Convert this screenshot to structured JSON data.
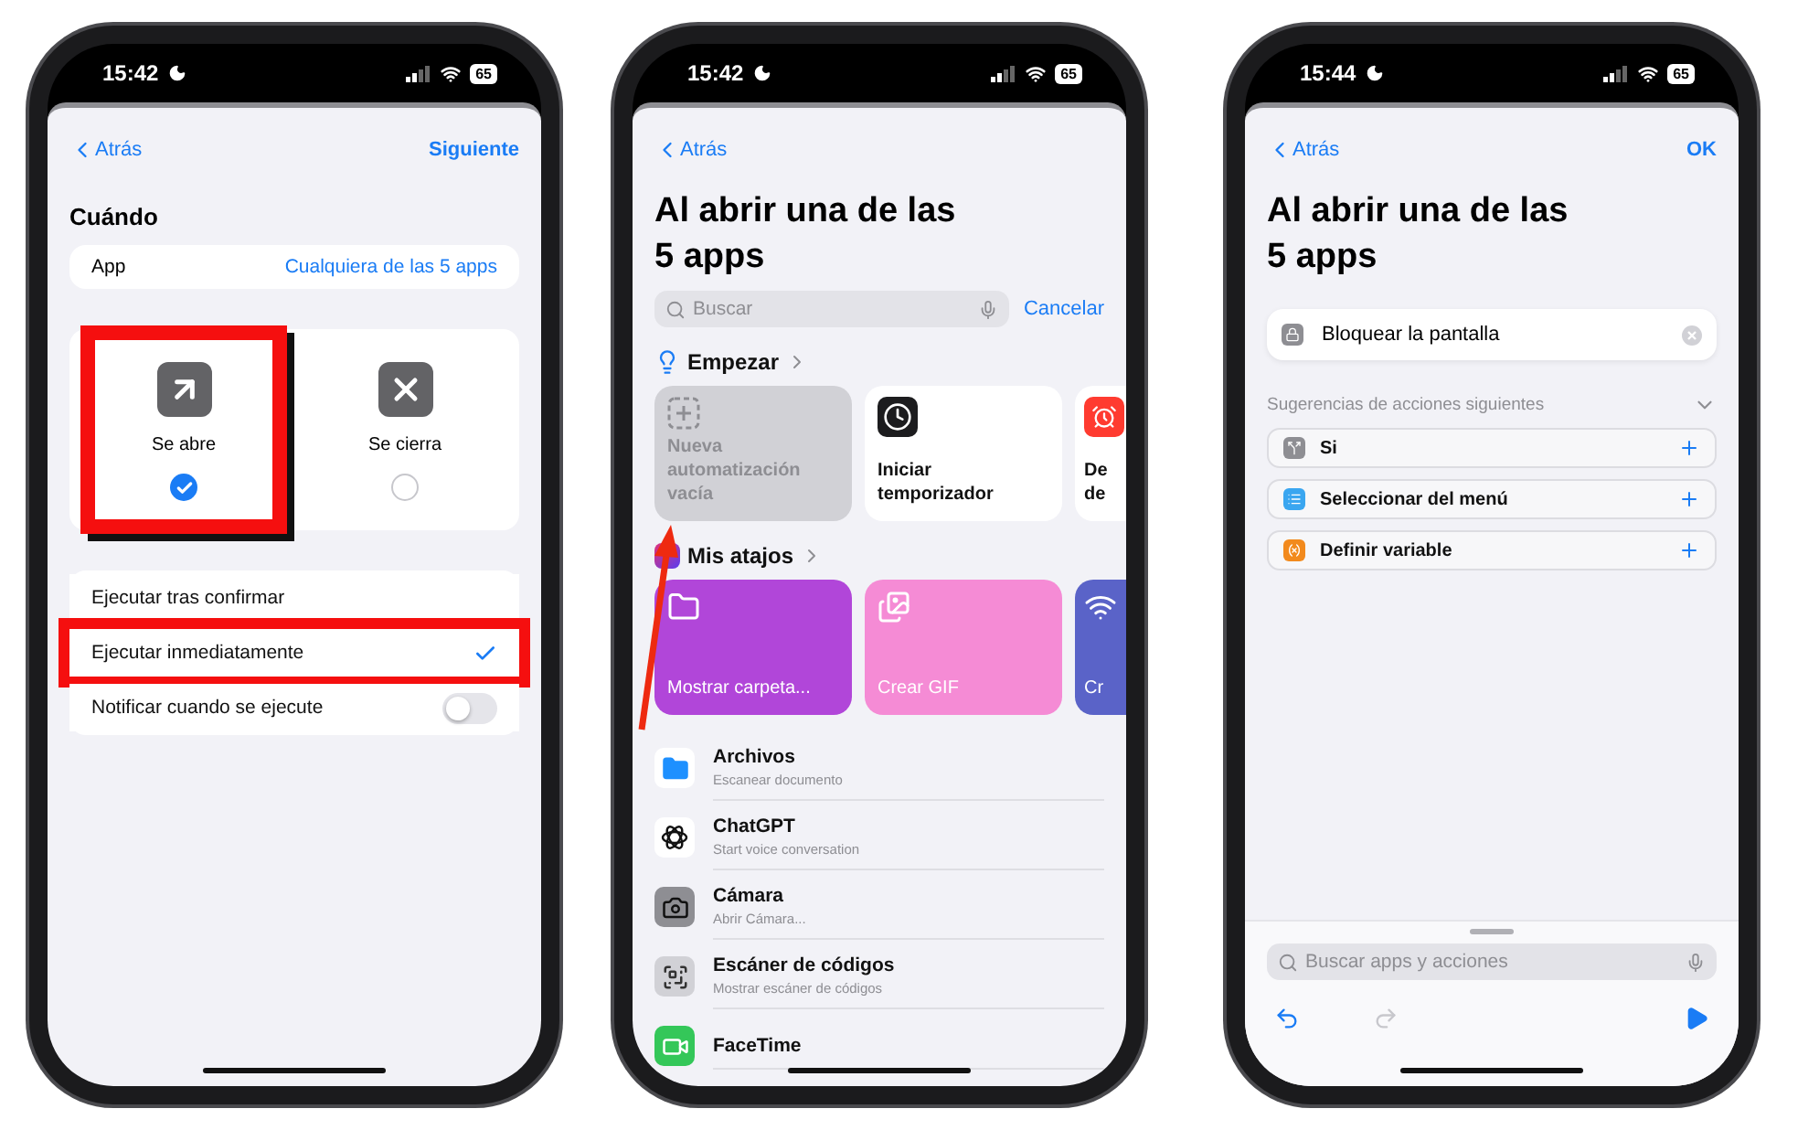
{
  "trigger_screen": {
    "status": {
      "time": "15:42",
      "battery": "65"
    },
    "nav": {
      "back": "Atrás",
      "action": "Siguiente"
    },
    "heading": "Cuándo",
    "app_row": {
      "label": "App",
      "value": "Cualquiera de las 5 apps"
    },
    "events": [
      {
        "label": "Se abre",
        "kind": "opens",
        "selected": true,
        "highlighted": true
      },
      {
        "label": "Se cierra",
        "kind": "closes",
        "selected": false,
        "highlighted": false
      }
    ],
    "run_options": [
      {
        "label": "Ejecutar tras confirmar",
        "kind": "choice",
        "selected": false,
        "highlighted": false
      },
      {
        "label": "Ejecutar inmediatamente",
        "kind": "choice",
        "selected": true,
        "highlighted": true
      },
      {
        "label": "Notificar cuando se ejecute",
        "kind": "toggle",
        "on": false,
        "highlighted": false
      }
    ]
  },
  "picker_screen": {
    "status": {
      "time": "15:42",
      "battery": "65"
    },
    "nav": {
      "back": "Atrás"
    },
    "title": "Al abrir una de las 5 apps",
    "search": {
      "placeholder": "Buscar",
      "cancel": "Cancelar"
    },
    "start_section": {
      "title": "Empezar",
      "cards": [
        {
          "label": "Nueva automatización vacía",
          "kind": "new",
          "disabled": true
        },
        {
          "label": "Iniciar temporizador",
          "kind": "timer",
          "disabled": false
        },
        {
          "label": "De de",
          "kind": "alarm",
          "disabled": false
        }
      ]
    },
    "shortcuts_section": {
      "title": "Mis atajos",
      "cards": [
        {
          "label": "Mostrar carpeta...",
          "kind": "folder",
          "color": "#b146d9"
        },
        {
          "label": "Crear GIF",
          "kind": "gif",
          "color": "#f58bd5"
        },
        {
          "label": "Cr",
          "kind": "wifi",
          "color": "#5a63c8"
        }
      ]
    },
    "apps": [
      {
        "name": "Archivos",
        "subtitle": "Escanear documento",
        "kind": "files"
      },
      {
        "name": "ChatGPT",
        "subtitle": "Start voice conversation",
        "kind": "chatgpt"
      },
      {
        "name": "Cámara",
        "subtitle": "Abrir Cámara...",
        "kind": "camera"
      },
      {
        "name": "Escáner de códigos",
        "subtitle": "Mostrar escáner de códigos",
        "kind": "scanner"
      },
      {
        "name": "FaceTime",
        "kind": "facetime"
      }
    ],
    "annotation_arrow": true
  },
  "editor_screen": {
    "status": {
      "time": "15:44",
      "battery": "65"
    },
    "nav": {
      "back": "Atrás",
      "action": "OK"
    },
    "title": "Al abrir una de las 5 apps",
    "action": {
      "label": "Bloquear la pantalla"
    },
    "suggestions": {
      "title": "Sugerencias de acciones siguientes",
      "items": [
        {
          "label": "Si",
          "kind": "if",
          "color": "#8e8e93"
        },
        {
          "label": "Seleccionar del menú",
          "kind": "menu",
          "color": "#3aa6f0"
        },
        {
          "label": "Definir variable",
          "kind": "variable",
          "color": "#f28a1d"
        }
      ]
    },
    "search": {
      "placeholder": "Buscar apps y acciones"
    },
    "toolbar": [
      {
        "kind": "undo",
        "disabled": false
      },
      {
        "kind": "redo",
        "disabled": true
      },
      {
        "kind": "run",
        "disabled": false
      }
    ]
  }
}
